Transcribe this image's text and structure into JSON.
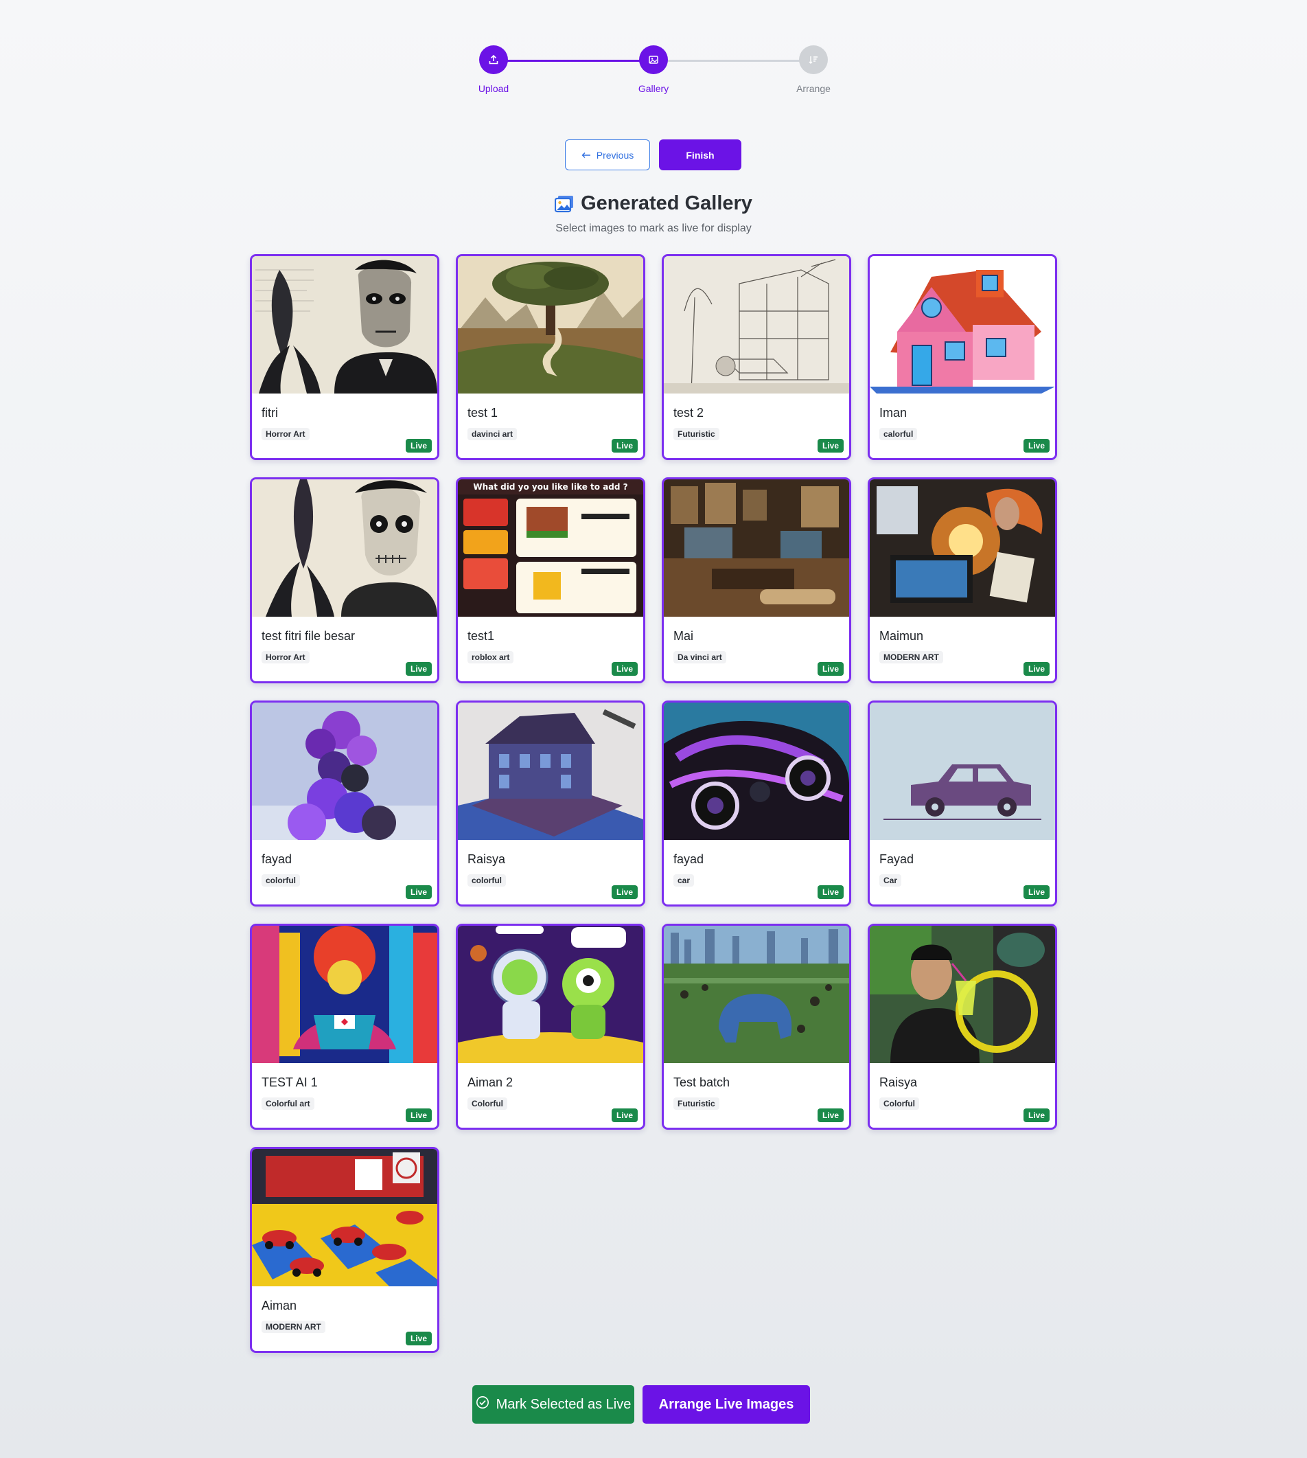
{
  "stepper": {
    "steps": [
      {
        "label": "Upload",
        "icon": "upload-icon",
        "state": "active"
      },
      {
        "label": "Gallery",
        "icon": "image-icon",
        "state": "active"
      },
      {
        "label": "Arrange",
        "icon": "sort-icon",
        "state": "inactive"
      }
    ]
  },
  "nav": {
    "previous_label": "Previous",
    "finish_label": "Finish"
  },
  "gallery": {
    "title": "Generated Gallery",
    "subtitle": "Select images to mark as live for display",
    "items": [
      {
        "name": "fitri",
        "category": "Horror Art",
        "status": "Live"
      },
      {
        "name": "test 1",
        "category": "davinci art",
        "status": "Live"
      },
      {
        "name": "test 2",
        "category": "Futuristic",
        "status": "Live"
      },
      {
        "name": "Iman",
        "category": "calorful",
        "status": "Live"
      },
      {
        "name": "test fitri file besar",
        "category": "Horror Art",
        "status": "Live"
      },
      {
        "name": "test1",
        "category": "roblox art",
        "status": "Live"
      },
      {
        "name": "Mai",
        "category": "Da vinci art",
        "status": "Live"
      },
      {
        "name": "Maimun",
        "category": "MODERN ART",
        "status": "Live"
      },
      {
        "name": "fayad",
        "category": "colorful",
        "status": "Live"
      },
      {
        "name": "Raisya",
        "category": "colorful",
        "status": "Live"
      },
      {
        "name": "fayad",
        "category": "car",
        "status": "Live"
      },
      {
        "name": "Fayad",
        "category": "Car",
        "status": "Live"
      },
      {
        "name": "TEST AI 1",
        "category": "Colorful art",
        "status": "Live"
      },
      {
        "name": "Aiman 2",
        "category": "Colorful",
        "status": "Live"
      },
      {
        "name": "Test batch",
        "category": "Futuristic",
        "status": "Live"
      },
      {
        "name": "Raisya",
        "category": "Colorful",
        "status": "Live"
      },
      {
        "name": "Aiman",
        "category": "MODERN ART",
        "status": "Live"
      }
    ]
  },
  "image_text": {
    "roblox_menu_heading": "What did yo you like like to add ?"
  },
  "actions": {
    "mark_live_label": "Mark Selected as Live",
    "arrange_label": "Arrange Live Images"
  },
  "colors": {
    "primary": "#6b13e6",
    "success": "#1a8a4a",
    "link": "#2f6fe0"
  }
}
